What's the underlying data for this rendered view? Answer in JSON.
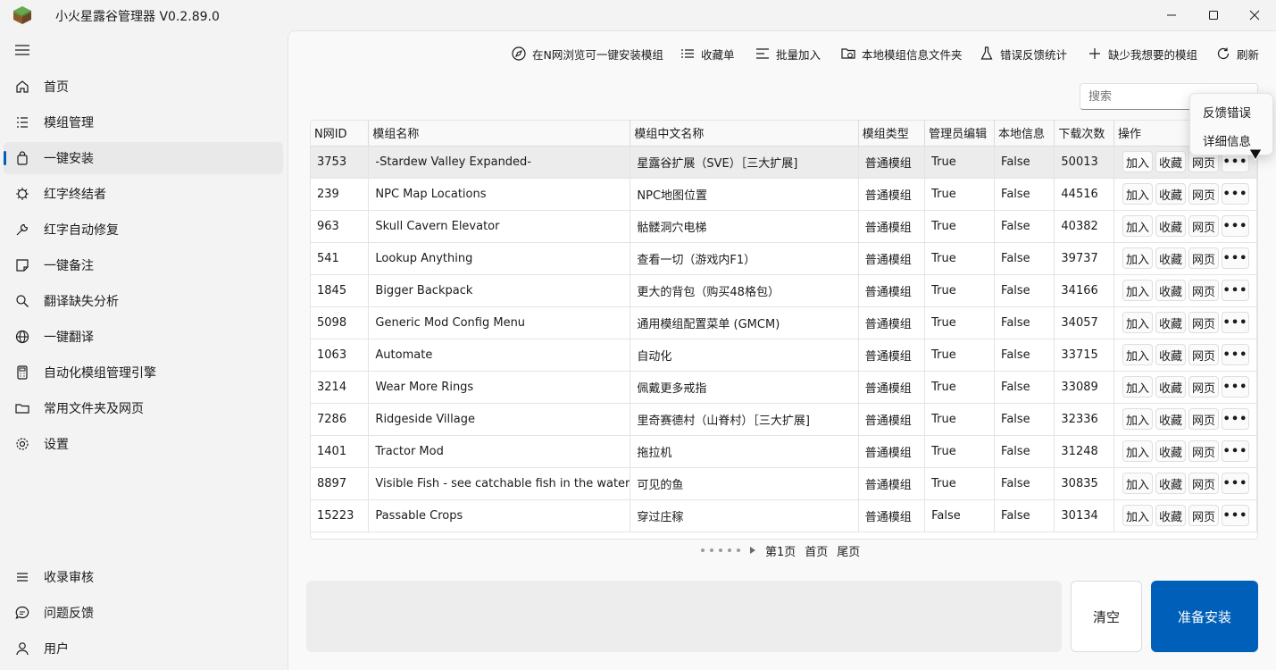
{
  "window": {
    "title": "小火星露谷管理器 V0.2.89.0",
    "minimize_icon": "minimize-icon",
    "maximize_icon": "maximize-icon",
    "close_icon": "close-icon"
  },
  "sidebar": {
    "items": [
      {
        "label": "首页",
        "icon": "home-icon"
      },
      {
        "label": "模组管理",
        "icon": "list-icon"
      },
      {
        "label": "一键安装",
        "icon": "shopping-bag-icon",
        "active": true
      },
      {
        "label": "红字终结者",
        "icon": "virus-icon"
      },
      {
        "label": "红字自动修复",
        "icon": "wrench-icon"
      },
      {
        "label": "一键备注",
        "icon": "note-icon"
      },
      {
        "label": "翻译缺失分析",
        "icon": "search-icon"
      },
      {
        "label": "一键翻译",
        "icon": "globe-icon"
      },
      {
        "label": "自动化模组管理引擎",
        "icon": "calculator-icon"
      },
      {
        "label": "常用文件夹及网页",
        "icon": "folder-icon"
      },
      {
        "label": "设置",
        "icon": "gear-icon"
      }
    ],
    "bottom_items": [
      {
        "label": "收录审核",
        "icon": "hamburger-icon"
      },
      {
        "label": "问题反馈",
        "icon": "chat-icon"
      },
      {
        "label": "用户",
        "icon": "user-icon"
      }
    ]
  },
  "toolbar": {
    "browse": "在N网浏览可一键安装模组",
    "favorites": "收藏单",
    "batch_add": "批量加入",
    "local_folder": "本地模组信息文件夹",
    "error_stats": "错误反馈统计",
    "missing_mod": "缺少我想要的模组",
    "refresh": "刷新"
  },
  "search": {
    "placeholder": "搜索"
  },
  "table": {
    "columns": [
      "N网ID",
      "模组名称",
      "模组中文名称",
      "模组类型",
      "管理员编辑",
      "本地信息",
      "下载次数",
      "操作"
    ],
    "op_labels": {
      "add": "加入",
      "fav": "收藏",
      "web": "网页",
      "more": "•••"
    },
    "rows": [
      [
        "3753",
        "-Stardew Valley Expanded-",
        "星露谷扩展（SVE）［三大扩展]",
        "普通模组",
        "True",
        "False",
        "50013"
      ],
      [
        "239",
        "NPC Map Locations",
        "NPC地图位置",
        "普通模组",
        "True",
        "False",
        "44516"
      ],
      [
        "963",
        "Skull Cavern Elevator",
        "骷髅洞穴电梯",
        "普通模组",
        "True",
        "False",
        "40382"
      ],
      [
        "541",
        "Lookup Anything",
        "查看一切（游戏内F1）",
        "普通模组",
        "True",
        "False",
        "39737"
      ],
      [
        "1845",
        "Bigger Backpack",
        "更大的背包（购买48格包）",
        "普通模组",
        "True",
        "False",
        "34166"
      ],
      [
        "5098",
        "Generic Mod Config Menu",
        "通用模组配置菜单 (GMCM)",
        "普通模组",
        "True",
        "False",
        "34057"
      ],
      [
        "1063",
        "Automate",
        "自动化",
        "普通模组",
        "True",
        "False",
        "33715"
      ],
      [
        "3214",
        "Wear More Rings",
        "佩戴更多戒指",
        "普通模组",
        "True",
        "False",
        "33089"
      ],
      [
        "7286",
        "Ridgeside Village",
        "里奇赛德村（山脊村）［三大扩展]",
        "普通模组",
        "True",
        "False",
        "32336"
      ],
      [
        "1401",
        "Tractor Mod",
        "拖拉机",
        "普通模组",
        "True",
        "False",
        "31248"
      ],
      [
        "8897",
        "Visible Fish - see catchable fish in the water",
        "可见的鱼",
        "普通模组",
        "True",
        "False",
        "30835"
      ],
      [
        "15223",
        "Passable Crops",
        "穿过庄稼",
        "普通模组",
        "False",
        "False",
        "30134"
      ]
    ]
  },
  "pager": {
    "current": "第1页",
    "first": "首页",
    "last": "尾页"
  },
  "bottom": {
    "clear": "清空",
    "install": "准备安装"
  },
  "context_menu": {
    "items": [
      "反馈错误",
      "详细信息"
    ]
  },
  "colors": {
    "accent": "#005fb8",
    "background": "#f3f3f3",
    "panel": "#f9f9f9"
  }
}
